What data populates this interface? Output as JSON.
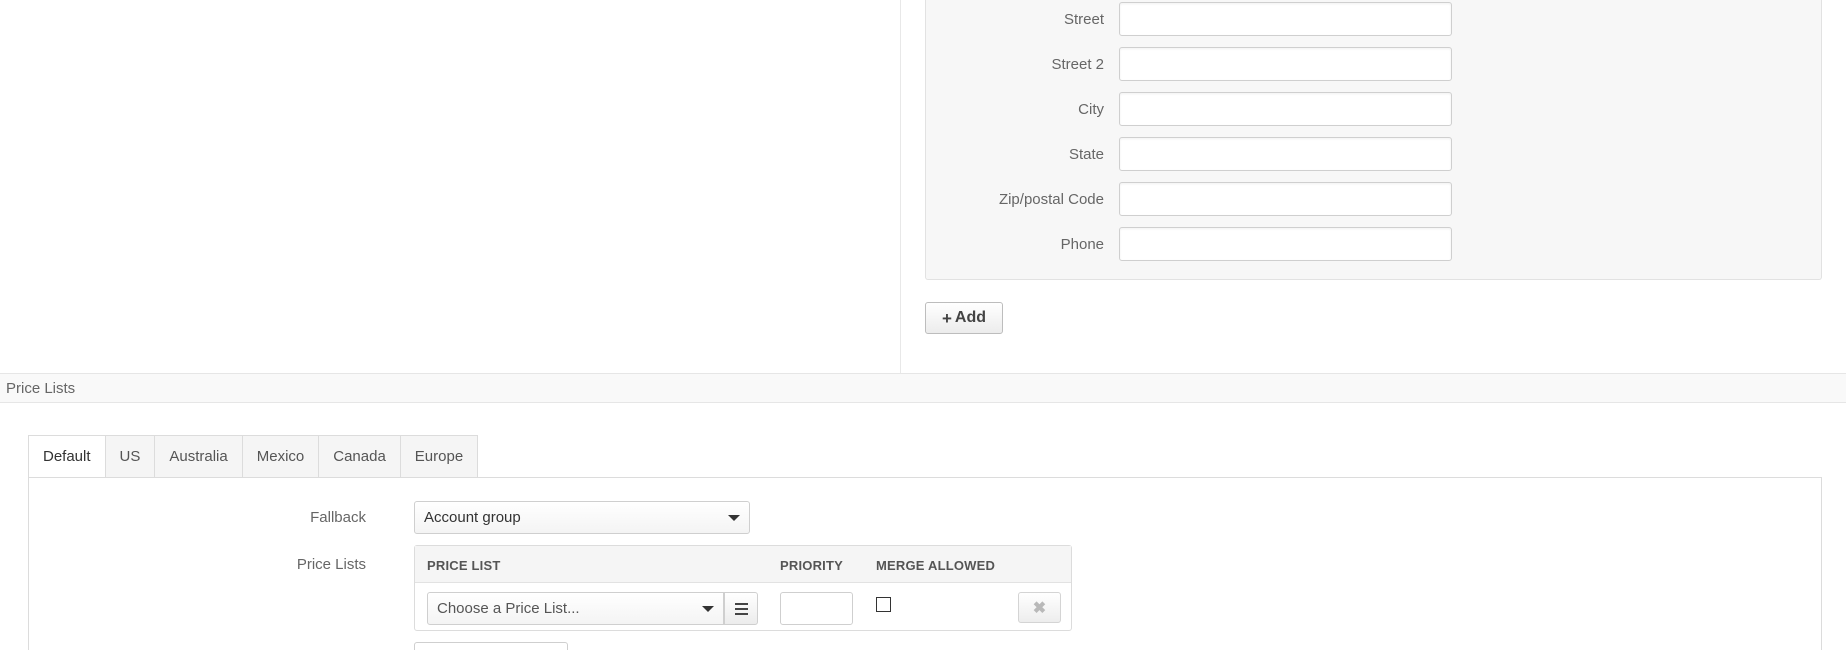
{
  "address_form": {
    "fields": [
      {
        "label": "Street",
        "value": ""
      },
      {
        "label": "Street 2",
        "value": ""
      },
      {
        "label": "City",
        "value": ""
      },
      {
        "label": "State",
        "value": ""
      },
      {
        "label": "Zip/postal Code",
        "value": ""
      },
      {
        "label": "Phone",
        "value": ""
      }
    ],
    "add_button": {
      "icon": "plus-icon",
      "label": "Add"
    }
  },
  "price_lists_section": {
    "title": "Price Lists",
    "tabs": [
      {
        "label": "Default",
        "active": true
      },
      {
        "label": "US",
        "active": false
      },
      {
        "label": "Australia",
        "active": false
      },
      {
        "label": "Mexico",
        "active": false
      },
      {
        "label": "Canada",
        "active": false
      },
      {
        "label": "Europe",
        "active": false
      }
    ],
    "fallback": {
      "label": "Fallback",
      "value": "Account group"
    },
    "price_lists": {
      "label": "Price Lists",
      "columns": [
        "PRICE LIST",
        "PRIORITY",
        "MERGE ALLOWED"
      ],
      "rows": [
        {
          "price_list_placeholder": "Choose a Price List...",
          "priority": "",
          "merge_allowed": false,
          "list_icon": "list-icon",
          "remove_icon": "close-icon"
        }
      ]
    }
  },
  "colors": {
    "panel_background": "#f7f7f7",
    "border": "#dcdcdc",
    "text": "#555555"
  }
}
